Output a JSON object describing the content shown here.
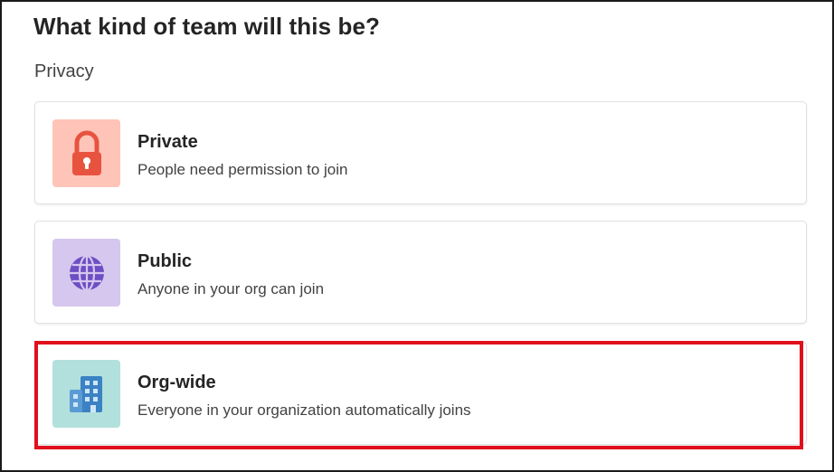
{
  "dialog": {
    "title": "What kind of team will this be?",
    "section_label": "Privacy"
  },
  "options": [
    {
      "name": "Private",
      "description": "People need permission to join",
      "icon": "lock-icon",
      "tile_color": "#ffc4b8",
      "icon_color": "#e8533f"
    },
    {
      "name": "Public",
      "description": "Anyone in your org can join",
      "icon": "globe-icon",
      "tile_color": "#d5c7ee",
      "icon_color": "#6e4ec4"
    },
    {
      "name": "Org-wide",
      "description": "Everyone in your organization automatically joins",
      "icon": "building-icon",
      "tile_color": "#b2e0dc",
      "icon_color": "#3b82c4"
    }
  ],
  "highlight_color": "#e0101c"
}
